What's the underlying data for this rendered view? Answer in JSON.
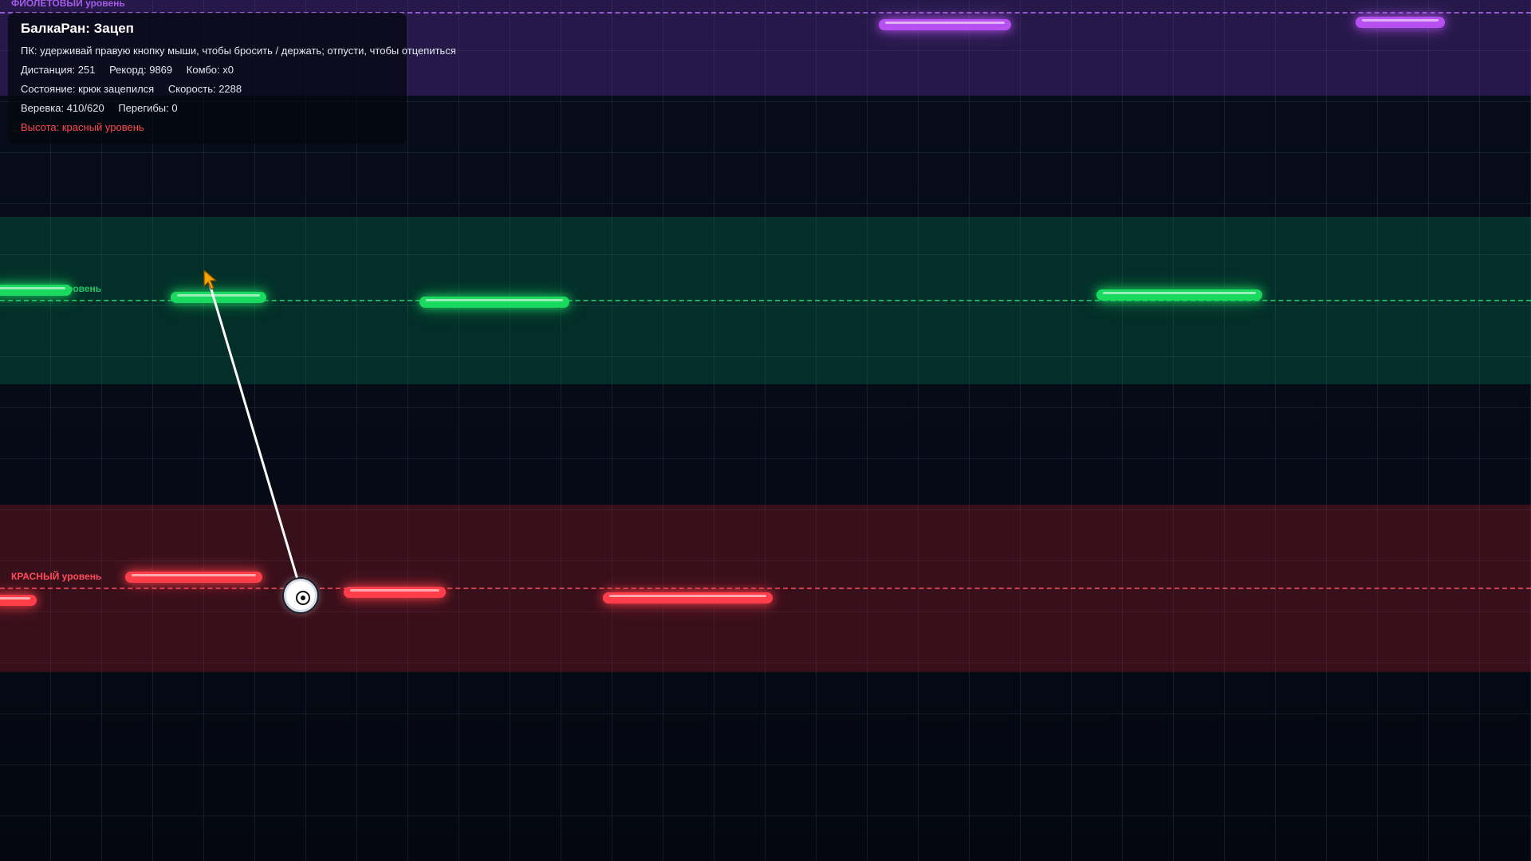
{
  "hud": {
    "title": "БалкаРан: Зацеп",
    "controls_hint": "ПК: удерживай правую кнопку мыши, чтобы бросить / держать; отпусти, чтобы отцепиться",
    "distance": "Дистанция: 251",
    "record": "Рекорд: 9869",
    "combo": "Комбо: x0",
    "state": "Состояние: крюк зацепился",
    "speed": "Скорость: 2288",
    "rope": "Веревка: 410/620",
    "bends": "Перегибы: 0",
    "height": "Высота: красный уровень"
  },
  "levels": {
    "purple_label": "ФИОЛЕТОВЫЙ уровень",
    "green_label": "ровень",
    "red_label": "КРАСНЫЙ уровень"
  },
  "colors": {
    "purple": "#b650f0",
    "green": "#19d95e",
    "red": "#ff3e4a",
    "alert_text": "#ff4b4b",
    "rope": "#ffffff",
    "cursor": "#f5a300"
  },
  "rope": {
    "current": 410,
    "max": 620,
    "bends": 0,
    "state": "hooked"
  },
  "icons": {
    "player": "player-ball-icon",
    "cursor": "mouse-cursor-icon"
  }
}
